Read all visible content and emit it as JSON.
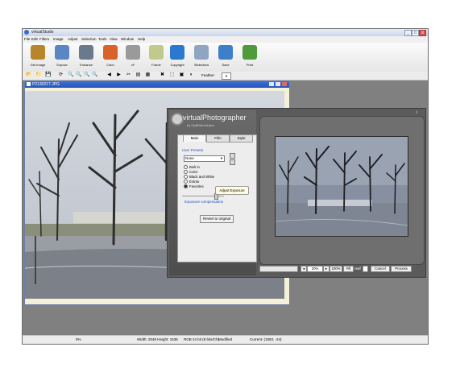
{
  "window": {
    "title": "virtualStudio",
    "min": "_",
    "max": "□",
    "close": "X"
  },
  "menu": [
    "File",
    "Edit",
    "Filters",
    "Image",
    "Adjust",
    "Selection",
    "Tools",
    "View",
    "Window",
    "Help"
  ],
  "ribbon": [
    {
      "label": "Get Image",
      "icon": "camera-icon",
      "color": "#b7862b"
    },
    {
      "label": "Expose",
      "icon": "picture-icon",
      "color": "#5b86c4"
    },
    {
      "label": "Enhance",
      "icon": "gears-icon",
      "color": "#6a7a8c"
    },
    {
      "label": "Color",
      "icon": "paint-drops-icon",
      "color": "#d8622a"
    },
    {
      "label": "vF",
      "icon": "disc-icon",
      "color": "#9a9a9a"
    },
    {
      "label": "Frame",
      "icon": "frame-icon",
      "color": "#c2c98c"
    },
    {
      "label": "Copyright",
      "icon": "copyright-icon",
      "color": "#2a78d0"
    },
    {
      "label": "Slideshow",
      "icon": "screen-icon",
      "color": "#8fa6c2"
    },
    {
      "label": "Save",
      "icon": "save-heart-icon",
      "color": "#3d7fc9"
    },
    {
      "label": "Print",
      "icon": "printer-icon",
      "color": "#4f9a3a"
    }
  ],
  "toolbar2": {
    "icons": [
      "open-icon",
      "folder-icon",
      "disk-icon",
      "rotate-icon",
      "zoom-in-icon",
      "zoom-out-icon",
      "zoom-fit-icon",
      "zoom-actual-icon",
      "back-icon",
      "forward-icon",
      "cut-icon",
      "copy-icon",
      "paste-icon",
      "crop-icon",
      "selection-icon",
      "layers-icon",
      "lasso-icon"
    ],
    "glyphs": [
      "📂",
      "📁",
      "💾",
      "⟳",
      "🔍",
      "🔍",
      "🔍",
      "🔍",
      "◀",
      "▶",
      "✂",
      "▤",
      "▦",
      "✖",
      "⬚",
      "▣",
      "◐"
    ],
    "feather_label": "Feather:",
    "feather_value": "0"
  },
  "document": {
    "title": "P2130217.JPG"
  },
  "dialog": {
    "logo": "virtualPhotographer",
    "subtitle": "by OptikVerveLabs",
    "tabs": [
      "Main",
      "Film",
      "Style"
    ],
    "group_label": "User Presets",
    "preset_value": "None",
    "radio_options": [
      "Built in",
      "Color",
      "Black and White",
      "Extras",
      "Favorites"
    ],
    "selected_radio": "Favorites",
    "tooltip": "Adjust Exposure",
    "slider_label": "Exposure compensation",
    "slider_level": 0.8,
    "revert_button": "Revert to original",
    "zoom_value": "20%",
    "fit_button": "100%",
    "fill_button": "Fill",
    "half_label": "Half",
    "cancel_button": "Cancel",
    "process_button": "Process",
    "info_glyph": "i"
  },
  "status": {
    "progress": "0%",
    "dimensions": "Width: 2048  Height: 1536",
    "mode": "RGB 24 bit (8 bits/Ch)",
    "modified": "Modified",
    "current": "Current: (1583, -24)"
  }
}
